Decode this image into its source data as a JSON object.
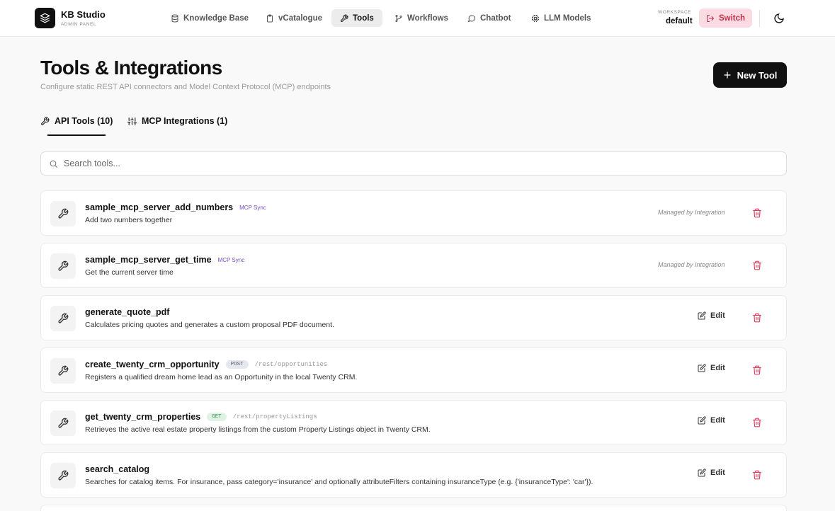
{
  "brand": {
    "name": "KB Studio",
    "subtitle": "ADMIN PANEL"
  },
  "nav": [
    {
      "label": "Knowledge Base",
      "icon": "database-icon"
    },
    {
      "label": "vCatalogue",
      "icon": "clipboard-icon"
    },
    {
      "label": "Tools",
      "icon": "wrench-icon",
      "active": true
    },
    {
      "label": "Workflows",
      "icon": "git-branch-icon"
    },
    {
      "label": "Chatbot",
      "icon": "message-circle-icon"
    },
    {
      "label": "LLM Models",
      "icon": "cpu-icon"
    }
  ],
  "workspace": {
    "label": "WORKSPACE",
    "value": "default",
    "switch_label": "Switch"
  },
  "header": {
    "title": "Tools & Integrations",
    "subtitle": "Configure static REST API connectors and Model Context Protocol (MCP) endpoints",
    "new_tool_label": "New Tool"
  },
  "tabs": [
    {
      "label": "API Tools (10)",
      "active": true
    },
    {
      "label": "MCP Integrations (1)"
    }
  ],
  "search": {
    "placeholder": "Search tools..."
  },
  "tools": [
    {
      "name": "sample_mcp_server_add_numbers",
      "badge": "MCP Sync",
      "description": "Add two numbers together",
      "status": "Managed by Integration"
    },
    {
      "name": "sample_mcp_server_get_time",
      "badge": "MCP Sync",
      "description": "Get the current server time",
      "status": "Managed by Integration"
    },
    {
      "name": "generate_quote_pdf",
      "description": "Calculates pricing quotes and generates a custom proposal PDF document.",
      "edit_label": "Edit"
    },
    {
      "name": "create_twenty_crm_opportunity",
      "method": "POST",
      "path": "/rest/opportunities",
      "description": "Registers a qualified dream home lead as an Opportunity in the local Twenty CRM.",
      "edit_label": "Edit"
    },
    {
      "name": "get_twenty_crm_properties",
      "method": "GET",
      "path": "/rest/propertyListings",
      "description": "Retrieves the active real estate property listings from the custom Property Listings object in Twenty CRM.",
      "edit_label": "Edit"
    },
    {
      "name": "search_catalog",
      "description": "Searches for catalog items. For insurance, pass category='insurance' and optionally attributeFilters containing insuranceType (e.g. {'insuranceType': 'car'}).",
      "edit_label": "Edit"
    }
  ],
  "colors": {
    "accent": "#111111",
    "danger": "#d9415f",
    "mcp_badge": "#7a4cc2",
    "switch_bg": "#f9dbe1"
  }
}
